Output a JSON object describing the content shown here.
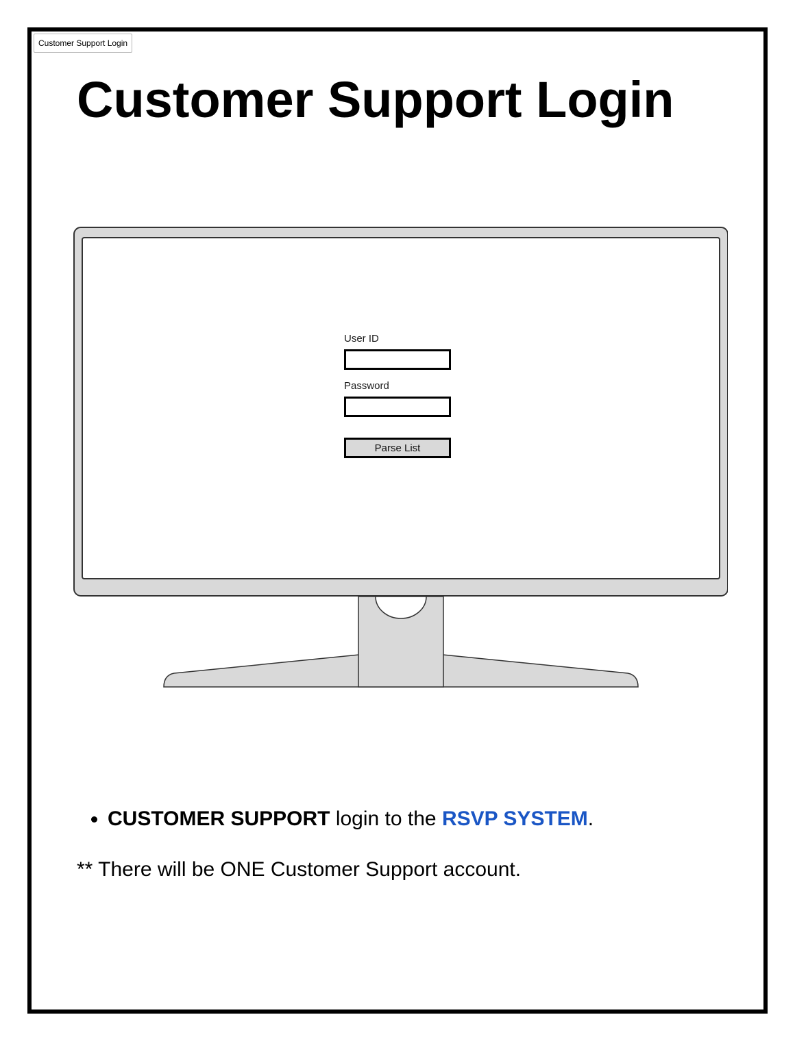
{
  "tab": {
    "label": "Customer Support Login"
  },
  "page": {
    "title": "Customer Support Login"
  },
  "login_form": {
    "user_id_label": "User ID",
    "user_id_value": "",
    "password_label": "Password",
    "password_value": "",
    "submit_label": "Parse List"
  },
  "notes": {
    "bullet": {
      "part1": "CUSTOMER SUPPORT",
      "part2": " login to the ",
      "part3": "RSVP SYSTEM",
      "part4": "."
    },
    "footnote": "** There will be ONE Customer Support account."
  },
  "colors": {
    "accent": "#1a56c5",
    "monitor_fill": "#d9d9d9",
    "outline": "#000000"
  },
  "icons": {
    "monitor": "monitor-icon"
  }
}
